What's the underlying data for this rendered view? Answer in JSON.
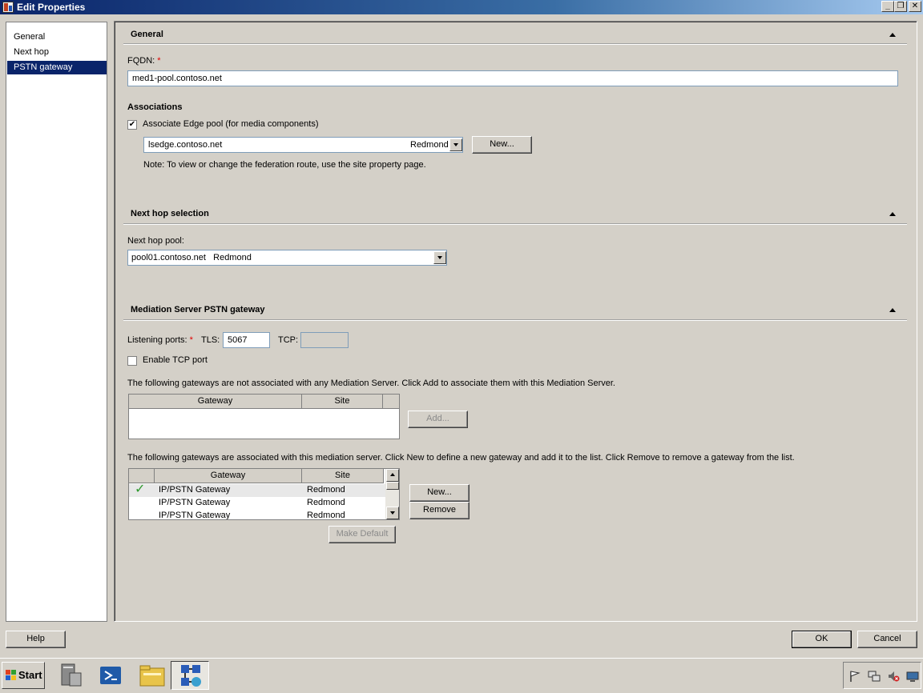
{
  "window": {
    "title": "Edit Properties",
    "min": "_",
    "restore": "❐",
    "close": "✕"
  },
  "nav": {
    "items": [
      {
        "label": "General"
      },
      {
        "label": "Next hop"
      },
      {
        "label": "PSTN gateway"
      }
    ]
  },
  "general": {
    "title": "General",
    "fqdn_label": "FQDN:",
    "required_mark": "*",
    "fqdn_value": "med1-pool.contoso.net",
    "associations_title": "Associations",
    "edge_checkbox_label": "Associate Edge pool (for media components)",
    "edge_checked": true,
    "edge_pool_value": "lsedge.contoso.net",
    "edge_pool_site": "Redmond",
    "new_button": "New...",
    "note": "Note: To view or change the federation route, use the site property page."
  },
  "next_hop": {
    "title": "Next hop selection",
    "pool_label": "Next hop pool:",
    "pool_value": "pool01.contoso.net   Redmond"
  },
  "pstn": {
    "title": "Mediation Server PSTN gateway",
    "ports_label": "Listening ports:",
    "required_mark": "*",
    "tls_label": "TLS:",
    "tls_value": "5067",
    "tcp_label": "TCP:",
    "tcp_value": "",
    "enable_tcp_label": "Enable TCP port",
    "enable_tcp_checked": false,
    "unassoc_text": "The following gateways are not associated with any Mediation Server.  Click Add to associate them with this Mediation Server.",
    "unassoc_headers": {
      "gateway": "Gateway",
      "site": "Site"
    },
    "add_button": "Add...",
    "assoc_text": "The following gateways are associated with this mediation server.  Click New to define a new gateway and add it to the list.  Click Remove to remove a gateway from the list.",
    "assoc_headers": {
      "gateway": "Gateway",
      "site": "Site"
    },
    "assoc_rows": [
      {
        "gateway": "IP/PSTN Gateway",
        "site": "Redmond",
        "is_default": true
      },
      {
        "gateway": "IP/PSTN Gateway",
        "site": "Redmond",
        "is_default": false
      },
      {
        "gateway": "IP/PSTN Gateway",
        "site": "Redmond",
        "is_default": false
      }
    ],
    "default_mark": "✓",
    "new_button": "New...",
    "remove_button": "Remove",
    "make_default_button": "Make Default"
  },
  "footer": {
    "help": "Help",
    "ok": "OK",
    "cancel": "Cancel"
  },
  "taskbar": {
    "start": "Start"
  }
}
